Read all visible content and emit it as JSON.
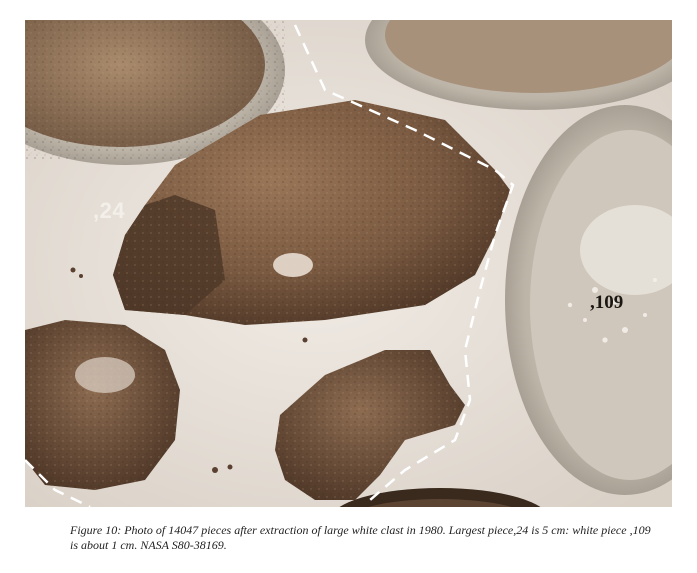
{
  "figure": {
    "labels": {
      "piece_24": ",24",
      "piece_109": ",109"
    },
    "caption": "Figure 10:  Photo of 14047 pieces after extraction of large white clast in 1980.  Largest piece,24  is 5 cm: white piece ,109 is about 1 cm.  NASA S80-38169.",
    "colors": {
      "background": "#e9e3dc",
      "rock": "#7a5a41",
      "rock_dark": "#4e3626",
      "tray": "#bfb6ab",
      "dashed_outline": "#ffffff"
    }
  }
}
